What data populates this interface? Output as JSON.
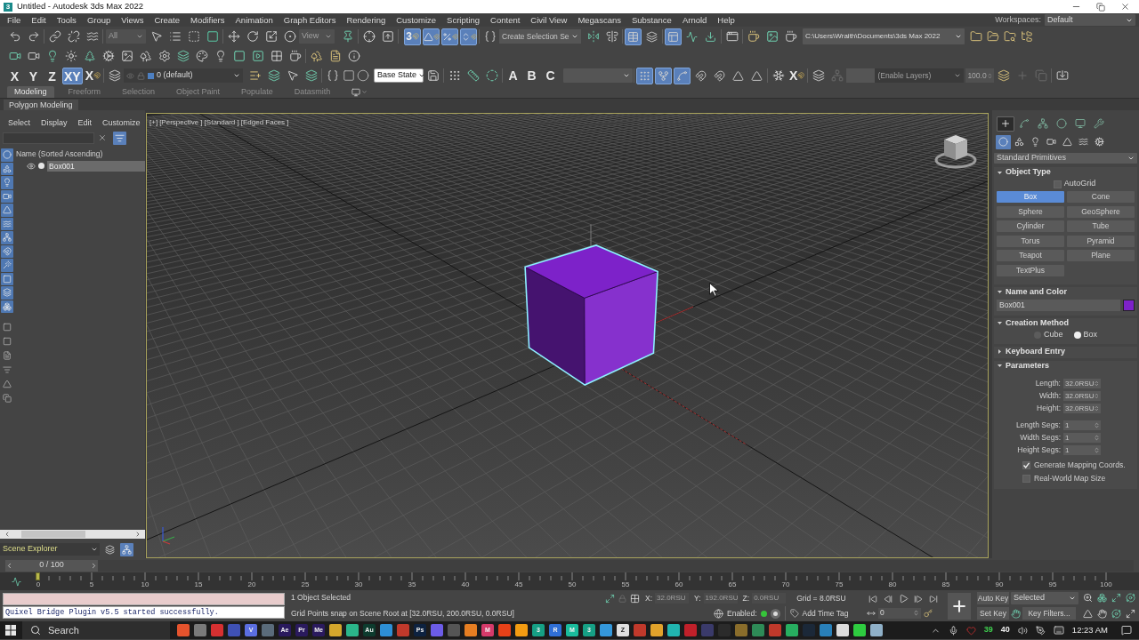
{
  "window": {
    "icon_label": "3",
    "title": "Untitled - Autodesk 3ds Max 2022"
  },
  "menu": {
    "items": [
      "File",
      "Edit",
      "Tools",
      "Group",
      "Views",
      "Create",
      "Modifiers",
      "Animation",
      "Graph Editors",
      "Rendering",
      "Customize",
      "Scripting",
      "Content",
      "Civil View",
      "Megascans",
      "Substance",
      "Arnold",
      "Help"
    ],
    "workspaces_label": "Workspaces:",
    "workspace": "Default"
  },
  "main_toolbar": {
    "selection_filter": "All",
    "reference_coordinate": "View",
    "snap_toggles": [
      {
        "kind": "snap",
        "label": "3",
        "on": true
      },
      {
        "kind": "angle",
        "on": true
      },
      {
        "kind": "percent",
        "on": true
      },
      {
        "kind": "spinner",
        "on": true
      }
    ],
    "named_selection": {
      "placeholder": "Create Selection Se"
    },
    "explorer_toggles": [
      {
        "on": true
      },
      {
        "on": false
      }
    ],
    "editor_toggles": [
      {
        "on": true
      },
      {
        "on": false
      },
      {
        "on": false
      }
    ],
    "project_folder": "C:\\Users\\Wraith\\Documents\\3ds Max 2022"
  },
  "axis_toolbar": {
    "axes": [
      {
        "label": "X",
        "selected": false
      },
      {
        "label": "Y",
        "selected": false
      },
      {
        "label": "Z",
        "selected": false
      },
      {
        "label": "XY",
        "selected": true
      }
    ],
    "axis_snap_label": "X",
    "layer": "0 (default)",
    "state_set": "Base State",
    "letter_tools": [
      "A",
      "B",
      "C"
    ],
    "snap_modes": [
      {
        "on": true
      },
      {
        "on": true
      },
      {
        "on": true
      },
      {
        "on": false
      },
      {
        "on": false
      },
      {
        "on": false
      },
      {
        "on": false
      }
    ],
    "xref_label": "X",
    "anim_layer": {
      "placeholder": "(Enable Layers)"
    },
    "anim_weight": "100.0"
  },
  "ribbon": {
    "tabs": [
      {
        "label": "Modeling",
        "selected": true
      },
      {
        "label": "Freeform",
        "selected": false
      },
      {
        "label": "Selection",
        "selected": false
      },
      {
        "label": "Object Paint",
        "selected": false
      },
      {
        "label": "Populate",
        "selected": false
      },
      {
        "label": "Datasmith",
        "selected": false
      }
    ],
    "panel": "Polygon Modeling"
  },
  "scene_explorer": {
    "menu": [
      "Select",
      "Display",
      "Edit",
      "Customize"
    ],
    "filter_on": true,
    "display_filters": [
      {
        "on": true
      },
      {
        "on": true
      },
      {
        "on": true
      },
      {
        "on": true
      },
      {
        "on": true
      },
      {
        "on": true
      },
      {
        "on": true
      },
      {
        "on": true
      },
      {
        "on": true
      },
      {
        "on": true
      },
      {
        "on": true
      },
      {
        "on": true
      }
    ],
    "column": "Name (Sorted Ascending)",
    "rows": [
      {
        "name": "Box001",
        "selected": true
      }
    ],
    "title": "Scene Explorer",
    "view_toggles": [
      {
        "on": false
      },
      {
        "on": true
      }
    ]
  },
  "viewport": {
    "labels": [
      "[+]",
      "[Perspective ]",
      "[Standard ]",
      "[Edged Faces ]"
    ],
    "active": true
  },
  "command_panel": {
    "tabs": [
      {
        "selected": true
      },
      {
        "selected": false
      },
      {
        "selected": false
      },
      {
        "selected": false
      },
      {
        "selected": false
      },
      {
        "selected": false
      }
    ],
    "categories": [
      {
        "selected": true
      },
      {
        "selected": false
      },
      {
        "selected": false
      },
      {
        "selected": false
      },
      {
        "selected": false
      },
      {
        "selected": false
      },
      {
        "selected": false
      }
    ],
    "category_dropdown": "Standard Primitives",
    "rollouts": [
      {
        "kind": "object_type",
        "title": "Object Type",
        "expanded": true,
        "autogrid": {
          "label": "AutoGrid",
          "checked": false
        },
        "buttons": [
          {
            "label": "Box",
            "selected": true
          },
          {
            "label": "Cone",
            "selected": false
          },
          {
            "label": "Sphere",
            "selected": false
          },
          {
            "label": "GeoSphere",
            "selected": false
          },
          {
            "label": "Cylinder",
            "selected": false
          },
          {
            "label": "Tube",
            "selected": false
          },
          {
            "label": "Torus",
            "selected": false
          },
          {
            "label": "Pyramid",
            "selected": false
          },
          {
            "label": "Teapot",
            "selected": false
          },
          {
            "label": "Plane",
            "selected": false
          },
          {
            "label": "TextPlus",
            "selected": false
          }
        ]
      },
      {
        "kind": "name_color",
        "title": "Name and Color",
        "expanded": true,
        "name": "Box001",
        "color": "#7d22c9"
      },
      {
        "kind": "creation_method",
        "title": "Creation Method",
        "expanded": true,
        "options": [
          {
            "label": "Cube",
            "selected": false
          },
          {
            "label": "Box",
            "selected": true
          }
        ]
      },
      {
        "kind": "keyboard_entry",
        "title": "Keyboard Entry",
        "expanded": false
      },
      {
        "kind": "parameters",
        "title": "Parameters",
        "expanded": true,
        "fields": [
          {
            "label": "Length:",
            "value": "32.0RSU"
          },
          {
            "label": "Width:",
            "value": "32.0RSU"
          },
          {
            "label": "Height:",
            "value": "32.0RSU"
          }
        ],
        "segs": [
          {
            "label": "Length Segs:",
            "value": "1"
          },
          {
            "label": "Width Segs:",
            "value": "1"
          },
          {
            "label": "Height Segs:",
            "value": "1"
          }
        ],
        "checks": [
          {
            "label": "Generate Mapping Coords.",
            "checked": true
          },
          {
            "label": "Real-World Map Size",
            "checked": false
          }
        ]
      }
    ]
  },
  "timeline": {
    "range": "0 / 100",
    "level": 0,
    "ticks": [
      "0",
      "5",
      "10",
      "15",
      "20",
      "25",
      "30",
      "35",
      "40",
      "45",
      "50",
      "55",
      "60",
      "65",
      "70",
      "75",
      "80",
      "85",
      "90",
      "95",
      "100"
    ]
  },
  "status": {
    "listener_output": "Quixel Bridge Plugin v5.5 started successfully.",
    "selection": "1 Object Selected",
    "prompt": "Grid Points snap on Scene Root at [32.0RSU, 200.0RSU, 0.0RSU]",
    "coords": [
      {
        "label": "X:",
        "value": "32.0RSU",
        "disabled": true
      },
      {
        "label": "Y:",
        "value": "192.0RSU",
        "disabled": true
      },
      {
        "label": "Z:",
        "value": "0.0RSU",
        "disabled": true
      }
    ],
    "grid": "Grid = 8.0RSU",
    "degradation_label": "Enabled:",
    "degradation_on": true,
    "time_tag": "Add Time Tag"
  },
  "animation": {
    "frame": "0",
    "auto_key": {
      "label": "Auto Key",
      "on": false
    },
    "key_mode": "Selected",
    "set_key": "Set Key",
    "key_filters": "Key Filters..."
  },
  "taskbar": {
    "search": "Search",
    "apps": [
      {
        "color": "#e5532d"
      },
      {
        "color": "#7a7a7a"
      },
      {
        "color": "#d63031"
      },
      {
        "color": "#3f51b5"
      },
      {
        "color": "#5b6ee1",
        "label": "V"
      },
      {
        "color": "#5a6b7a"
      },
      {
        "color": "#2a1a5e",
        "label": "Ae"
      },
      {
        "color": "#2a1a5e",
        "label": "Pr"
      },
      {
        "color": "#2a1a5e",
        "label": "Me"
      },
      {
        "color": "#d4a72c"
      },
      {
        "color": "#2bb58a"
      },
      {
        "color": "#0d3b2e",
        "label": "Au"
      },
      {
        "color": "#2d8fd5"
      },
      {
        "color": "#c0392b"
      },
      {
        "color": "#0d2240",
        "label": "Ps"
      },
      {
        "color": "#6c5ce7"
      },
      {
        "color": "#555555"
      },
      {
        "color": "#e67e22"
      },
      {
        "color": "#d63a6a",
        "label": "M"
      },
      {
        "color": "#e84118"
      },
      {
        "color": "#f39c12"
      },
      {
        "color": "#16a085",
        "label": "3"
      },
      {
        "color": "#2f6fd6",
        "label": "R"
      },
      {
        "color": "#1abc9c",
        "label": "M"
      },
      {
        "color": "#16a085",
        "label": "3"
      },
      {
        "color": "#3498db"
      },
      {
        "color": "#e0e0e0",
        "label": "Z"
      },
      {
        "color": "#c0392b"
      },
      {
        "color": "#e1a32b"
      },
      {
        "color": "#21b5b0"
      },
      {
        "color": "#c0202a"
      },
      {
        "color": "#3a3a6a"
      },
      {
        "color": "#2b2b2b"
      },
      {
        "color": "#8a6d2b"
      },
      {
        "color": "#2e8b57"
      },
      {
        "color": "#c0392b"
      },
      {
        "color": "#27ae60"
      },
      {
        "color": "#1b2838"
      },
      {
        "color": "#2980b9"
      },
      {
        "color": "#dcdcdc"
      },
      {
        "color": "#2ecc40"
      },
      {
        "color": "#8fb0c8"
      }
    ],
    "readings": [
      {
        "text": "39",
        "color": "#3fcf4f"
      },
      {
        "text": "40",
        "color": "#f0f0f0"
      }
    ],
    "time": "12:23 AM"
  }
}
